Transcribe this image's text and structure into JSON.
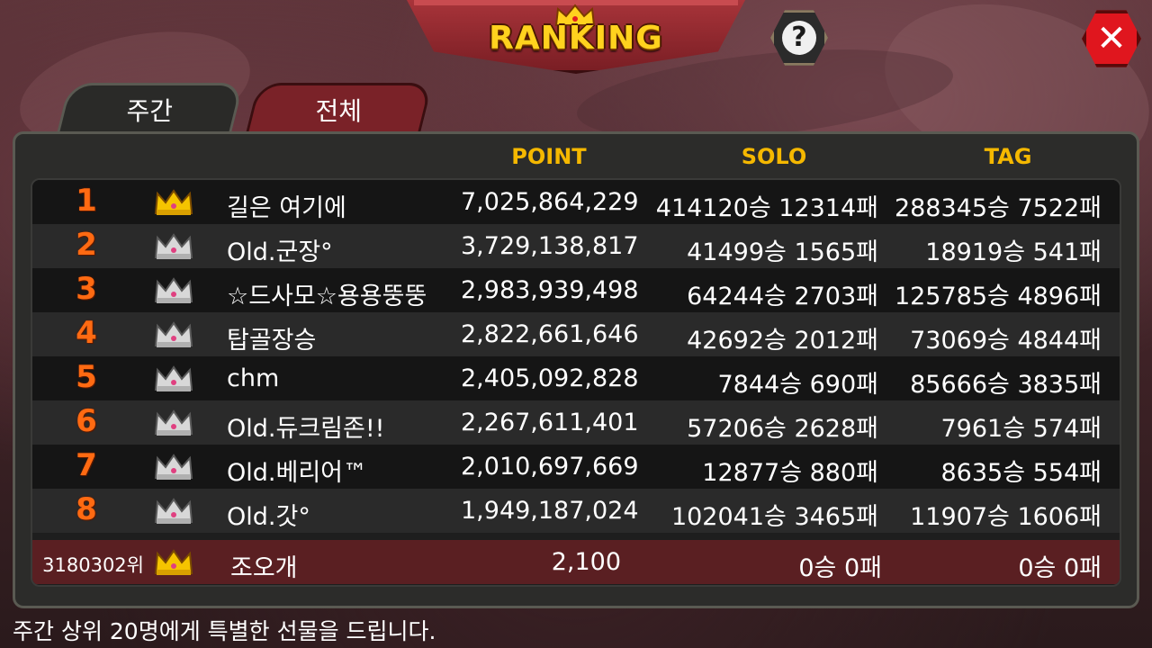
{
  "header": {
    "title": "RANKING",
    "help_label": "?",
    "close_label": "✕"
  },
  "tabs": [
    {
      "label": "주간"
    },
    {
      "label": "전체"
    }
  ],
  "columns": {
    "point": "POINT",
    "solo": "SOLO",
    "tag": "TAG"
  },
  "rows": [
    {
      "rank": "1",
      "crown": "gold",
      "name": "길은 여기에",
      "point": "7,025,864,229",
      "solo": "414120승 12314패",
      "tag": "288345승 7522패"
    },
    {
      "rank": "2",
      "crown": "silver",
      "name": "Old.군장°",
      "point": "3,729,138,817",
      "solo": "41499승 1565패",
      "tag": "18919승 541패"
    },
    {
      "rank": "3",
      "crown": "silver",
      "name": "☆드사모☆용용뚱뚱",
      "point": "2,983,939,498",
      "solo": "64244승 2703패",
      "tag": "125785승 4896패"
    },
    {
      "rank": "4",
      "crown": "silver",
      "name": "탑골장승",
      "point": "2,822,661,646",
      "solo": "42692승 2012패",
      "tag": "73069승 4844패"
    },
    {
      "rank": "5",
      "crown": "silver",
      "name": "chm",
      "point": "2,405,092,828",
      "solo": "7844승 690패",
      "tag": "85666승 3835패"
    },
    {
      "rank": "6",
      "crown": "silver",
      "name": "Old.듀크림존!!",
      "point": "2,267,611,401",
      "solo": "57206승 2628패",
      "tag": "7961승 574패"
    },
    {
      "rank": "7",
      "crown": "silver",
      "name": "Old.베리어™",
      "point": "2,010,697,669",
      "solo": "12877승 880패",
      "tag": "8635승 554패"
    },
    {
      "rank": "8",
      "crown": "silver",
      "name": "Old.갓°",
      "point": "1,949,187,024",
      "solo": "102041승 3465패",
      "tag": "11907승 1606패"
    }
  ],
  "my_row": {
    "rank": "3180302위",
    "crown": "gold",
    "name": "조오개",
    "point": "2,100",
    "solo": "0승 0패",
    "tag": "0승 0패"
  },
  "footer": "주간 상위 20명에게 특별한 선물을 드립니다.",
  "colors": {
    "accent": "#f5b800",
    "rank": "#ff6a12",
    "tab_active": "#7a2228",
    "close": "#e0161e",
    "gold": "#f5c400",
    "silver": "#d8d8d8"
  }
}
